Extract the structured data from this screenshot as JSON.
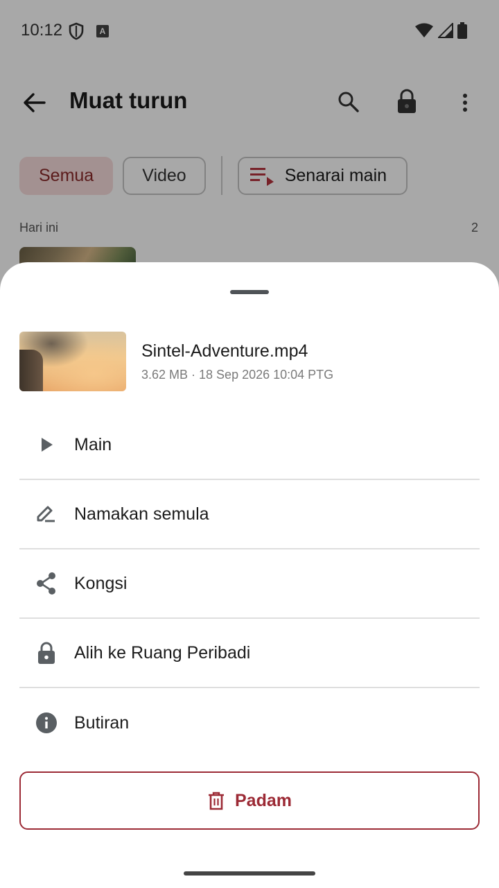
{
  "status_bar": {
    "time": "10:12"
  },
  "app_bar": {
    "title": "Muat turun"
  },
  "filters": {
    "all": "Semua",
    "video": "Video",
    "playlist": "Senarai main"
  },
  "section": {
    "label": "Hari ini",
    "count": "2"
  },
  "sheet": {
    "file": {
      "name": "Sintel-Adventure.mp4",
      "meta": "3.62 MB · 18 Sep 2026 10:04 PTG"
    },
    "actions": [
      {
        "label": "Main",
        "icon": "play-icon"
      },
      {
        "label": "Namakan semula",
        "icon": "edit-icon"
      },
      {
        "label": "Kongsi",
        "icon": "share-icon"
      },
      {
        "label": "Alih ke Ruang Peribadi",
        "icon": "lock-icon"
      },
      {
        "label": "Butiran",
        "icon": "info-icon"
      }
    ],
    "delete_label": "Padam"
  },
  "colors": {
    "accent": "#9c2a35",
    "chip_active_bg": "#f8dcdc",
    "icon": "#5a5f63"
  }
}
